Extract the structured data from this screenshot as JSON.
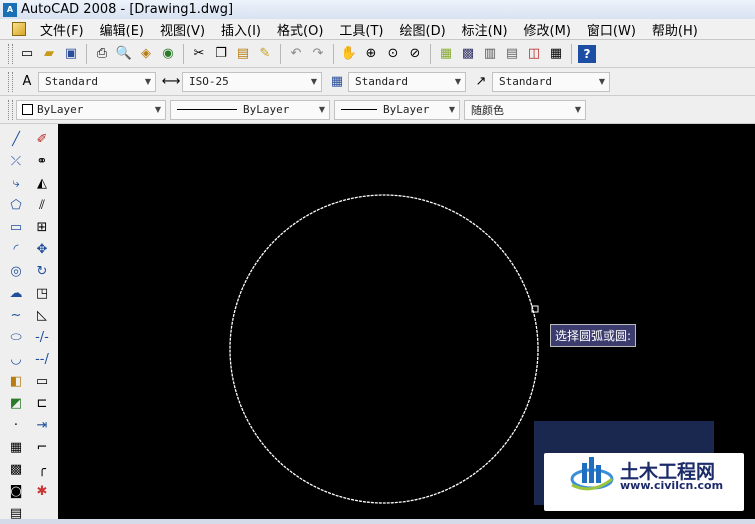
{
  "window": {
    "title": "AutoCAD 2008 - [Drawing1.dwg]"
  },
  "menu": {
    "items": [
      "文件(F)",
      "编辑(E)",
      "视图(V)",
      "插入(I)",
      "格式(O)",
      "工具(T)",
      "绘图(D)",
      "标注(N)",
      "修改(M)",
      "窗口(W)",
      "帮助(H)"
    ]
  },
  "styles_toolbar": {
    "text_style": "Standard",
    "dim_style": "ISO-25",
    "table_style": "Standard",
    "multileader_style": "Standard"
  },
  "properties_toolbar": {
    "color": "ByLayer",
    "linetype": "ByLayer",
    "lineweight": "ByLayer",
    "plot_style": "随颜色"
  },
  "canvas": {
    "tooltip": "选择圆弧或圆:",
    "background": "#000000"
  },
  "watermark": {
    "name": "土木工程网",
    "url": "www.civilcn.com"
  },
  "icons": {
    "standard": [
      "new-icon",
      "open-icon",
      "save-icon",
      "print-icon",
      "print-preview-icon",
      "publish-icon",
      "3d-dwf-icon",
      "cut-icon",
      "copy-icon",
      "paste-icon",
      "match-properties-icon",
      "undo-icon",
      "redo-icon",
      "pan-icon",
      "zoom-realtime-icon",
      "zoom-window-icon",
      "zoom-previous-icon",
      "properties-icon",
      "design-center-icon",
      "tool-palettes-icon",
      "sheet-set-icon",
      "markup-icon",
      "quickcalc-icon",
      "help-icon"
    ],
    "draw": [
      "line-icon",
      "construction-line-icon",
      "polyline-icon",
      "polygon-icon",
      "rectangle-icon",
      "arc-icon",
      "circle-icon",
      "revision-cloud-icon",
      "spline-icon",
      "ellipse-icon",
      "ellipse-arc-icon",
      "insert-block-icon",
      "make-block-icon",
      "point-icon",
      "hatch-icon",
      "gradient-icon",
      "region-icon",
      "table-icon",
      "multiline-text-icon"
    ],
    "modify": [
      "erase-icon",
      "copy-object-icon",
      "mirror-icon",
      "offset-icon",
      "array-icon",
      "move-icon",
      "rotate-icon",
      "scale-icon",
      "stretch-icon",
      "trim-icon",
      "extend-icon",
      "break-at-point-icon",
      "break-icon",
      "join-icon",
      "chamfer-icon",
      "fillet-icon",
      "explode-icon"
    ]
  }
}
